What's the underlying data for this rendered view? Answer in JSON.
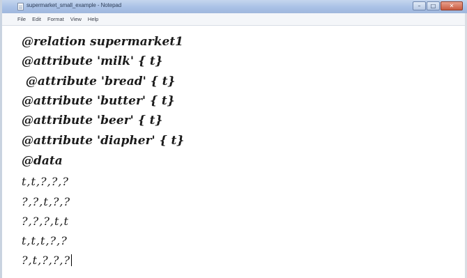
{
  "window": {
    "title": "supermarket_small_example - Notepad",
    "controls": {
      "minimize": "–",
      "maximize": "□",
      "close": "✕"
    }
  },
  "menu": [
    "File",
    "Edit",
    "Format",
    "View",
    "Help"
  ],
  "editor": {
    "lines": [
      "@relation supermarket1",
      "@attribute 'milk' { t}",
      " @attribute 'bread' { t}",
      "@attribute 'butter' { t}",
      "@attribute 'beer' { t}",
      "@attribute 'diapher' { t}",
      "@data",
      "t,t,?,?,?",
      "?,?,t,?,?",
      "?,?,?,t,t",
      "t,t,t,?,?",
      "?,t,?,?,?"
    ]
  },
  "icons": {
    "app": "notepad-icon"
  }
}
